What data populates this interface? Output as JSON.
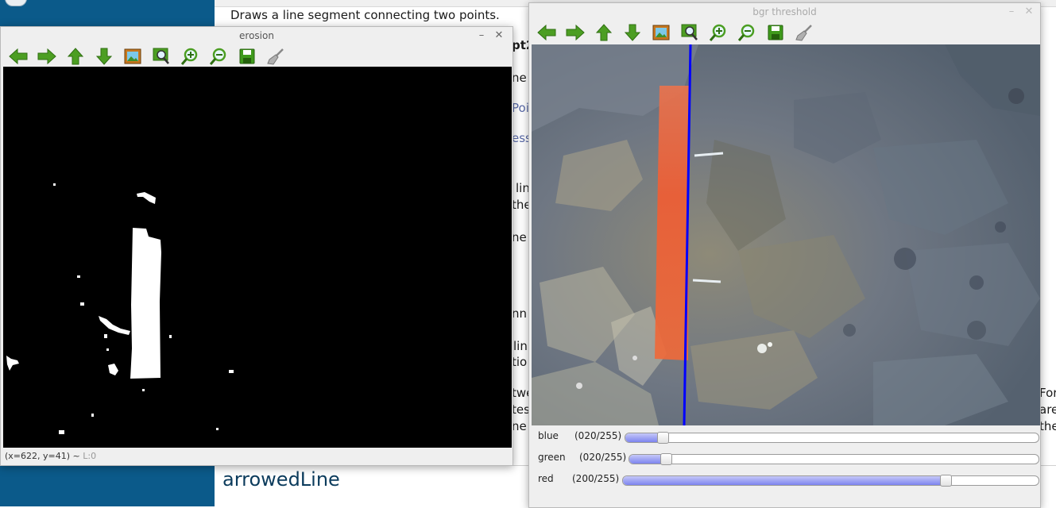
{
  "doc": {
    "heading_line": "Draws a line segment connecting two points.",
    "fragments": [
      "pt2",
      "ne",
      "Poi",
      "ess",
      "lin",
      "the",
      "ne",
      "nn",
      "lin",
      "tio",
      "twe",
      "tes",
      "ne",
      "For",
      "are",
      "the"
    ],
    "section_title": "arrowedLine"
  },
  "erosion_window": {
    "title": "erosion",
    "minimize": "–",
    "close": "✕",
    "toolbar": [
      {
        "name": "pan-left",
        "icon": "arrow-left-icon"
      },
      {
        "name": "pan-right",
        "icon": "arrow-right-icon"
      },
      {
        "name": "pan-up",
        "icon": "arrow-up-icon"
      },
      {
        "name": "pan-down",
        "icon": "arrow-down-icon"
      },
      {
        "name": "zoom-fit",
        "icon": "image-icon"
      },
      {
        "name": "zoom-original",
        "icon": "magnifier-image-icon"
      },
      {
        "name": "zoom-in",
        "icon": "zoom-in-icon"
      },
      {
        "name": "zoom-out",
        "icon": "zoom-out-icon"
      },
      {
        "name": "save",
        "icon": "floppy-disk-icon"
      },
      {
        "name": "properties",
        "icon": "brush-icon"
      }
    ],
    "status": "(x=622, y=41) ~",
    "status_level": "L:0"
  },
  "bgr_window": {
    "title": "bgr threshold",
    "minimize": "–",
    "close": "✕",
    "trackbars": [
      {
        "label": "blue",
        "value_text": "(020/255)",
        "value": 20,
        "max": 255
      },
      {
        "label": "green",
        "value_text": "(020/255)",
        "value": 20,
        "max": 255
      },
      {
        "label": "red",
        "value_text": "(200/255)",
        "value": 200,
        "max": 255
      }
    ]
  },
  "colors": {
    "sidebar": "#0b5a8a",
    "trackbar_fill": "#7d84ef",
    "blue_line": "#0000ff",
    "orange_strip": "#f26a3f",
    "toolbar_green": "#3f9a1c"
  }
}
